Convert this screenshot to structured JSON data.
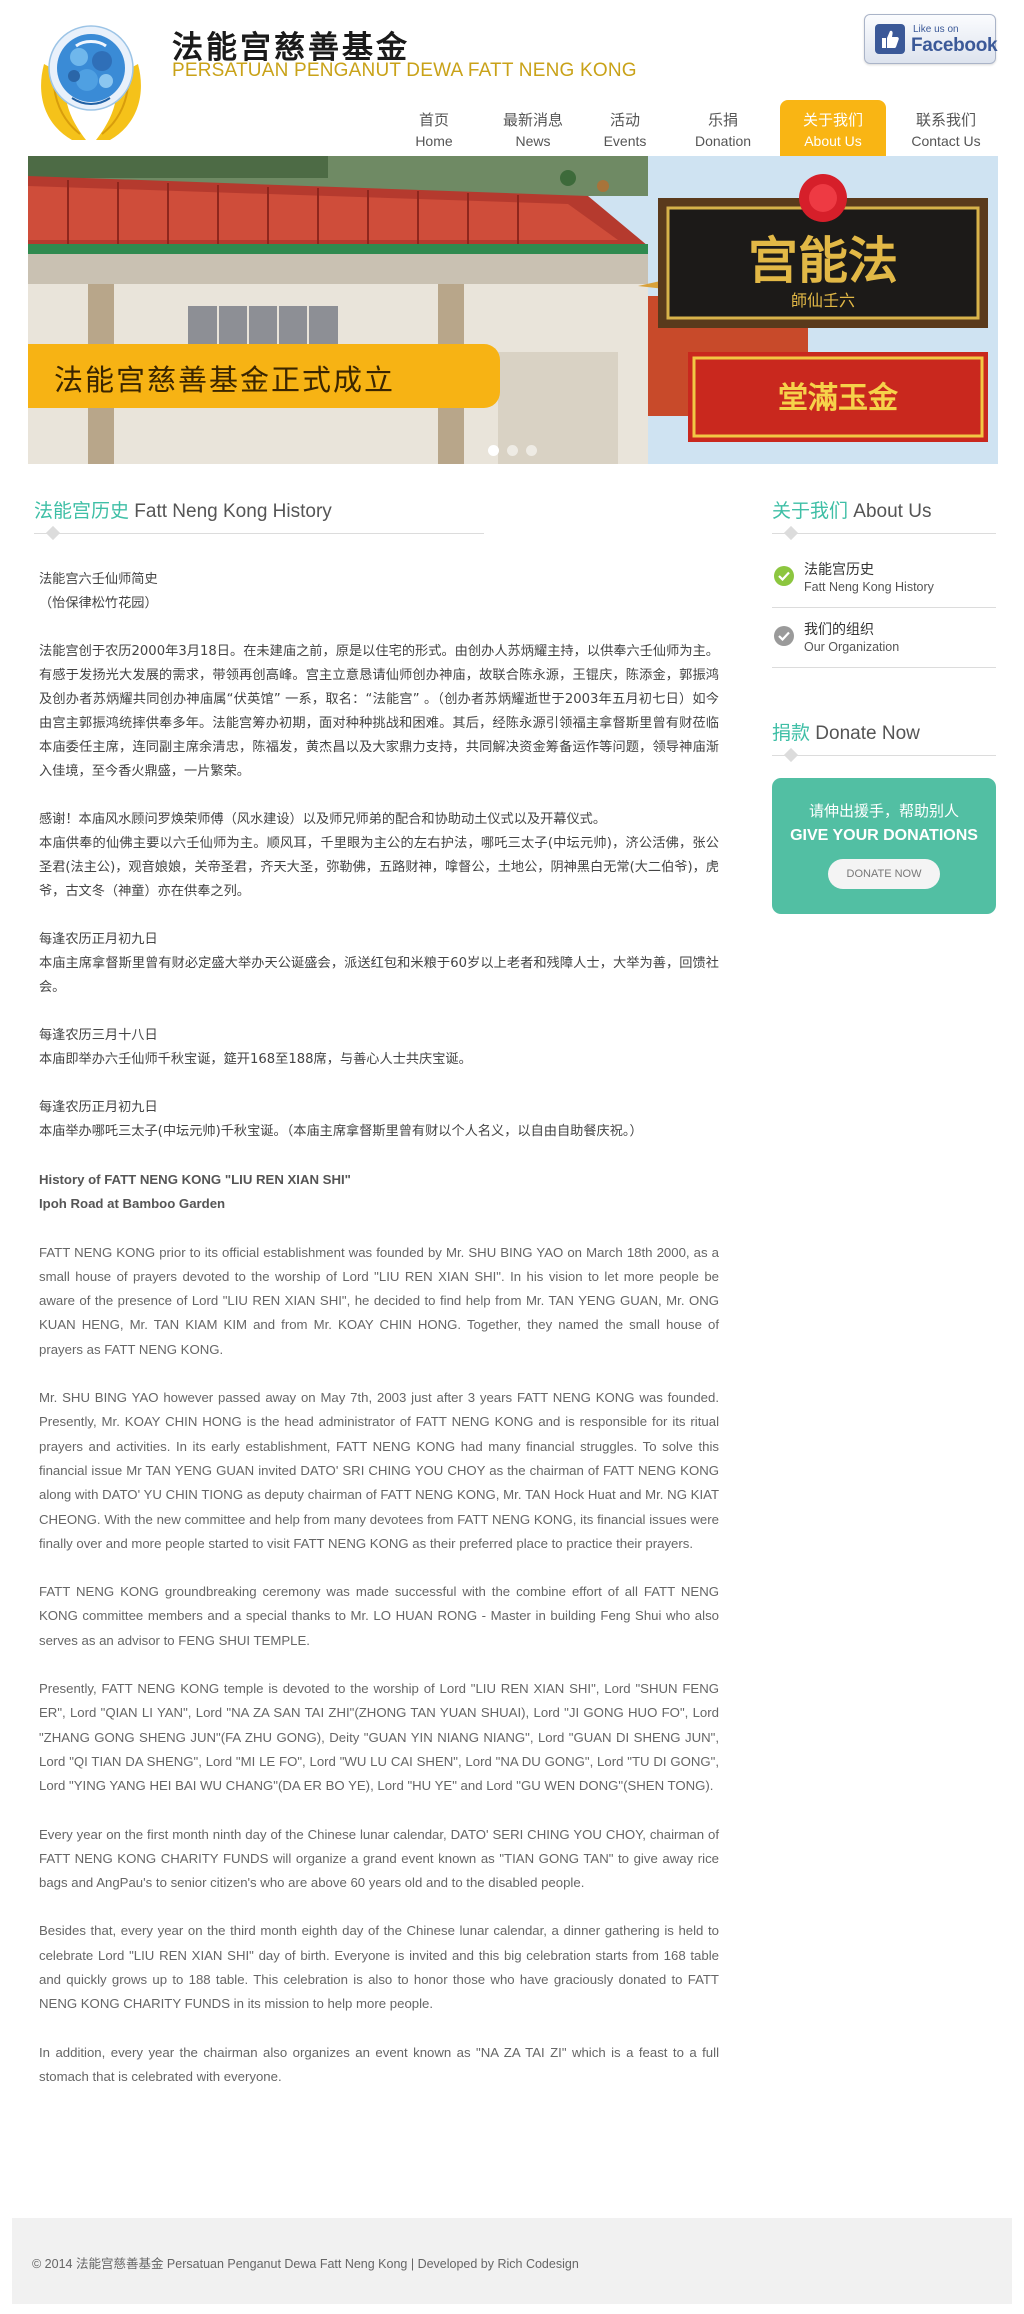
{
  "header": {
    "brand_cn": "法能宫慈善基金",
    "brand_en": "PERSATUAN PENGANUT DEWA FATT NENG KONG",
    "facebook": {
      "like_text": "Like us on",
      "word": "Facebook",
      "icon": "thumbs-up-icon"
    }
  },
  "nav": [
    {
      "cn": "首页",
      "en": "Home",
      "active": false
    },
    {
      "cn": "最新消息",
      "en": "News",
      "active": false
    },
    {
      "cn": "活动",
      "en": "Events",
      "active": false
    },
    {
      "cn": "乐捐",
      "en": "Donation",
      "active": false
    },
    {
      "cn": "关于我们",
      "en": "About Us",
      "active": true
    },
    {
      "cn": "联系我们",
      "en": "Contact Us",
      "active": false
    }
  ],
  "banner": {
    "caption": "法能宫慈善基金正式成立",
    "signboard_main": "宫能法",
    "signboard_sub": "師仙壬六",
    "red_board": "堂滿玉金",
    "slides": 3,
    "active_slide": 0
  },
  "main": {
    "title_cn": "法能宫历史",
    "title_en": "Fatt Neng Kong History",
    "paragraphs": [
      {
        "text": "法能宫六壬仙师简史\n（怡保律松竹花园）",
        "cls": ""
      },
      {
        "text": "法能宫创于农历2000年3月18日。在未建庙之前，原是以住宅的形式。由创办人苏炳耀主持，以供奉六壬仙师为主。有感于发扬光大发展的需求，带领再创高峰。宫主立意恳请仙师创办神庙，故联合陈永源，王锟庆，陈添金，郭振鸿及创办者苏炳耀共同创办神庙属“伏英馆” 一系，取名：“法能宫” 。（创办者苏炳耀逝世于2003年五月初七日）如今由宫主郭振鸿统摔供奉多年。法能宫筹办初期，面对种种挑战和困难。其后，经陈永源引领福主拿督斯里曾有财莅临本庙委任主席，连同副主席余清忠，陈福发，黄杰昌以及大家鼎力支持，共同解决资金筹备运作等问题，领导神庙渐入佳境，至今香火鼎盛，一片繁荣。",
        "cls": ""
      },
      {
        "text": "感谢！本庙风水顾问罗焕荣师傅（风水建设）以及师兄师弟的配合和协助动土仪式以及开幕仪式。\n本庙供奉的仙佛主要以六壬仙师为主。顺风耳，千里眼为主公的左右护法，哪吒三太子(中坛元帅)，济公活佛，张公圣君(法主公)，观音娘娘，关帝圣君，齐天大圣，弥勒佛，五路财神，嗱督公，土地公，阴神黑白无常(大二伯爷)，虎爷，古文冬（神童）亦在供奉之列。",
        "cls": ""
      },
      {
        "text": "每逢农历正月初九日\n本庙主席拿督斯里曾有财必定盛大举办天公诞盛会，派送红包和米粮于60岁以上老者和残障人士，大举为善，回馈社会。",
        "cls": ""
      },
      {
        "text": "每逢农历三月十八日\n本庙即举办六壬仙师千秋宝诞，筵开168至188席，与善心人士共庆宝诞。",
        "cls": ""
      },
      {
        "text": "每逢农历正月初九日\n本庙举办哪吒三太子(中坛元帅)千秋宝诞。（本庙主席拿督斯里曾有财以个人名义，以自由自助餐庆祝。）",
        "cls": ""
      },
      {
        "text": "History of FATT NENG KONG \"LIU REN XIAN SHI\"\nIpoh Road at Bamboo Garden",
        "cls": "en heading"
      },
      {
        "text": "FATT NENG KONG prior to its official establishment was founded by Mr. SHU BING YAO on March 18th 2000, as a small house of prayers devoted to the worship of Lord \"LIU REN XIAN SHI\". In his vision to let more people be aware of the presence of Lord \"LIU REN XIAN SHI\", he decided to find help from Mr. TAN YENG GUAN, Mr. ONG KUAN HENG, Mr. TAN KIAM KIM and from Mr. KOAY CHIN HONG. Together, they named the small house of prayers as FATT NENG KONG.",
        "cls": "en"
      },
      {
        "text": "Mr. SHU BING YAO however passed away on May 7th, 2003 just after 3 years FATT NENG KONG was founded. Presently, Mr. KOAY CHIN HONG is the head administrator of FATT NENG KONG and is responsible for its ritual prayers and activities. In its early establishment, FATT NENG KONG had many financial struggles. To solve this financial issue Mr TAN YENG GUAN invited DATO' SRI CHING YOU CHOY as the chairman of FATT NENG KONG along with DATO' YU CHIN TIONG as deputy chairman of FATT NENG KONG, Mr. TAN Hock Huat and Mr. NG KIAT CHEONG. With the new committee and help from many devotees from FATT NENG KONG, its financial issues were finally over and more people started to visit FATT NENG KONG as their preferred place to practice their prayers.",
        "cls": "en"
      },
      {
        "text": "FATT NENG KONG groundbreaking ceremony was made successful with the combine effort of all FATT NENG KONG committee members and a special thanks to Mr. LO HUAN RONG - Master in building Feng Shui who also serves as an advisor to FENG SHUI TEMPLE.",
        "cls": "en"
      },
      {
        "text": "Presently, FATT NENG KONG temple is devoted to the worship of Lord \"LIU REN XIAN SHI\", Lord \"SHUN FENG ER\", Lord \"QIAN LI YAN\", Lord \"NA ZA SAN TAI ZHI\"(ZHONG TAN YUAN SHUAI), Lord \"JI GONG HUO FO\", Lord \"ZHANG GONG SHENG JUN\"(FA ZHU GONG), Deity \"GUAN YIN NIANG NIANG\", Lord \"GUAN DI SHENG JUN\", Lord \"QI TIAN DA SHENG\", Lord \"MI LE FO\", Lord \"WU LU CAI SHEN\", Lord \"NA DU GONG\", Lord \"TU DI GONG\", Lord \"YING YANG HEI BAI WU CHANG\"(DA ER BO YE), Lord \"HU YE\" and Lord \"GU WEN DONG\"(SHEN TONG).",
        "cls": "en"
      },
      {
        "text": "Every year on the first month ninth day of the Chinese lunar calendar, DATO' SERI CHING YOU CHOY, chairman of FATT NENG KONG CHARITY FUNDS will organize a grand event known as \"TIAN GONG TAN\" to give away rice bags and AngPau's to senior citizen's who are above 60 years old and to the disabled people.",
        "cls": "en"
      },
      {
        "text": "Besides that, every year on the third month eighth day of the Chinese lunar calendar, a dinner gathering is held to celebrate Lord \"LIU REN XIAN SHI\" day of birth. Everyone is invited and this big celebration starts from 168 table and quickly grows up to 188 table. This celebration is also to honor those who have graciously donated to FATT NENG KONG CHARITY FUNDS in its mission to help more people.",
        "cls": "en"
      },
      {
        "text": "In addition, every year the chairman also organizes an event known as \"NA ZA TAI ZI\" which is a feast to a full stomach that is celebrated with everyone.",
        "cls": "en"
      }
    ]
  },
  "sidebar": {
    "about_cn": "关于我们",
    "about_en": "About Us",
    "items": [
      {
        "cn": "法能宫历史",
        "en": "Fatt Neng Kong History",
        "active": true
      },
      {
        "cn": "我们的组织",
        "en": "Our Organization",
        "active": false
      }
    ],
    "donate_cn": "捐款",
    "donate_en": "Donate Now",
    "donate_box_cn": "请伸出援手，帮助别人",
    "donate_box_en": "GIVE YOUR DONATIONS",
    "donate_button": "DONATE NOW"
  },
  "footer": {
    "text": "© 2014 法能宫慈善基金  Persatuan Penganut Dewa Fatt Neng Kong  |   Developed by Rich Codesign"
  },
  "colors": {
    "accent_teal": "#3fbfa6",
    "nav_active": "#f9b514",
    "brand_gold": "#c9a218",
    "donate_box": "#52bfa3"
  }
}
